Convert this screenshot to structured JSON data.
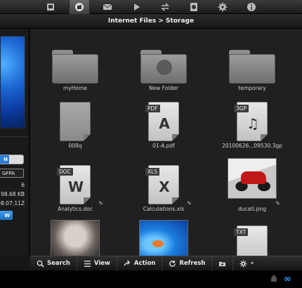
{
  "topbar": {
    "tabs": [
      {
        "icon": "screenshot-icon",
        "active": false
      },
      {
        "icon": "files-icon",
        "active": true
      },
      {
        "icon": "sms-icon",
        "active": false
      },
      {
        "icon": "play-icon",
        "active": false
      },
      {
        "icon": "transfer-icon",
        "active": false
      },
      {
        "icon": "apps-icon",
        "active": false
      },
      {
        "icon": "settings-icon",
        "active": false
      },
      {
        "icon": "info-icon",
        "active": false
      }
    ]
  },
  "title": "Internet Files > Storage",
  "leftpane": {
    "toggle_label": "N",
    "field_value": "GFPA",
    "line1": "6",
    "line2": "98.68 KB",
    "line3": "08:07:11Z",
    "button_label": "W"
  },
  "files": [
    {
      "name": "myHome",
      "kind": "folder"
    },
    {
      "name": "New Folder",
      "kind": "folder-globe"
    },
    {
      "name": "temporary",
      "kind": "folder"
    },
    {
      "name": "008q",
      "kind": "doc-plain"
    },
    {
      "name": "01-A.pdf",
      "kind": "doc",
      "badge": "PDF",
      "glyph": "A"
    },
    {
      "name": "20100626...09530.3gp",
      "kind": "doc",
      "badge": "3GP",
      "glyph": "♫"
    },
    {
      "name": "Analytics.doc",
      "kind": "doc",
      "badge": "DOC",
      "glyph": "W"
    },
    {
      "name": "Calculations.xls",
      "kind": "doc",
      "badge": "XLS",
      "glyph": "X"
    },
    {
      "name": "ducati.png",
      "kind": "photo-ducati"
    },
    {
      "name": "",
      "kind": "photo-face"
    },
    {
      "name": "",
      "kind": "photo-win7"
    },
    {
      "name": "",
      "kind": "doc",
      "badge": "TXT",
      "glyph": ""
    }
  ],
  "toolbar": {
    "search": "Search",
    "view": "View",
    "action": "Action",
    "refresh": "Refresh"
  },
  "colors": {
    "accent": "#2a7fd4",
    "background": "#202020"
  }
}
